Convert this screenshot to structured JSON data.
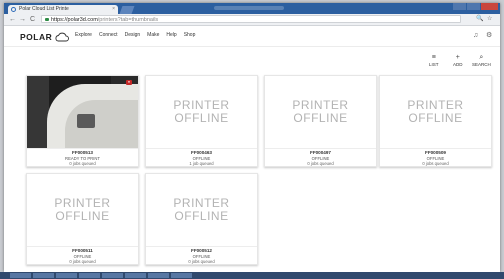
{
  "browser": {
    "tab_title": "Polar Cloud List Printe",
    "tab_close": "×",
    "url_host": "https://polar3d.com",
    "url_path": "/printers?tab=thumbnails",
    "back": "←",
    "forward": "→",
    "reload": "C",
    "zoom_glyph": "🔍",
    "star_glyph": "☆"
  },
  "app": {
    "logo_text": "POLAR",
    "nav": [
      "Explore",
      "Connect",
      "Design",
      "Make",
      "Help",
      "Shop"
    ],
    "bell_glyph": "♫",
    "settings_glyph": "⚙"
  },
  "actions": [
    {
      "label": "LIST",
      "icon": "list-icon",
      "glyph": "≡"
    },
    {
      "label": "ADD",
      "icon": "add-icon",
      "glyph": "+"
    },
    {
      "label": "SEARCH",
      "icon": "search-icon",
      "glyph": "⌕"
    }
  ],
  "offline_text": {
    "line1": "PRINTER",
    "line2": "OFFLINE"
  },
  "live_badge": "●",
  "printers": [
    {
      "name": "FF000513",
      "status": "READY TO PRINT",
      "jobs": "0 jobs queued",
      "camera": true
    },
    {
      "name": "FF000463",
      "status": "OFFLINE",
      "jobs": "1 job queued",
      "camera": false
    },
    {
      "name": "FF000497",
      "status": "OFFLINE",
      "jobs": "0 jobs queued",
      "camera": false
    },
    {
      "name": "FF000509",
      "status": "OFFLINE",
      "jobs": "0 jobs queued",
      "camera": false
    },
    {
      "name": "FF000511",
      "status": "OFFLINE",
      "jobs": "0 jobs queued",
      "camera": false
    },
    {
      "name": "FF000512",
      "status": "OFFLINE",
      "jobs": "0 jobs queued",
      "camera": false
    }
  ],
  "colors": {
    "titlebar": "#2c5fa0",
    "offline_text": "#b3b3b3",
    "live_badge": "#c62828",
    "taskbar": "#31496d"
  }
}
